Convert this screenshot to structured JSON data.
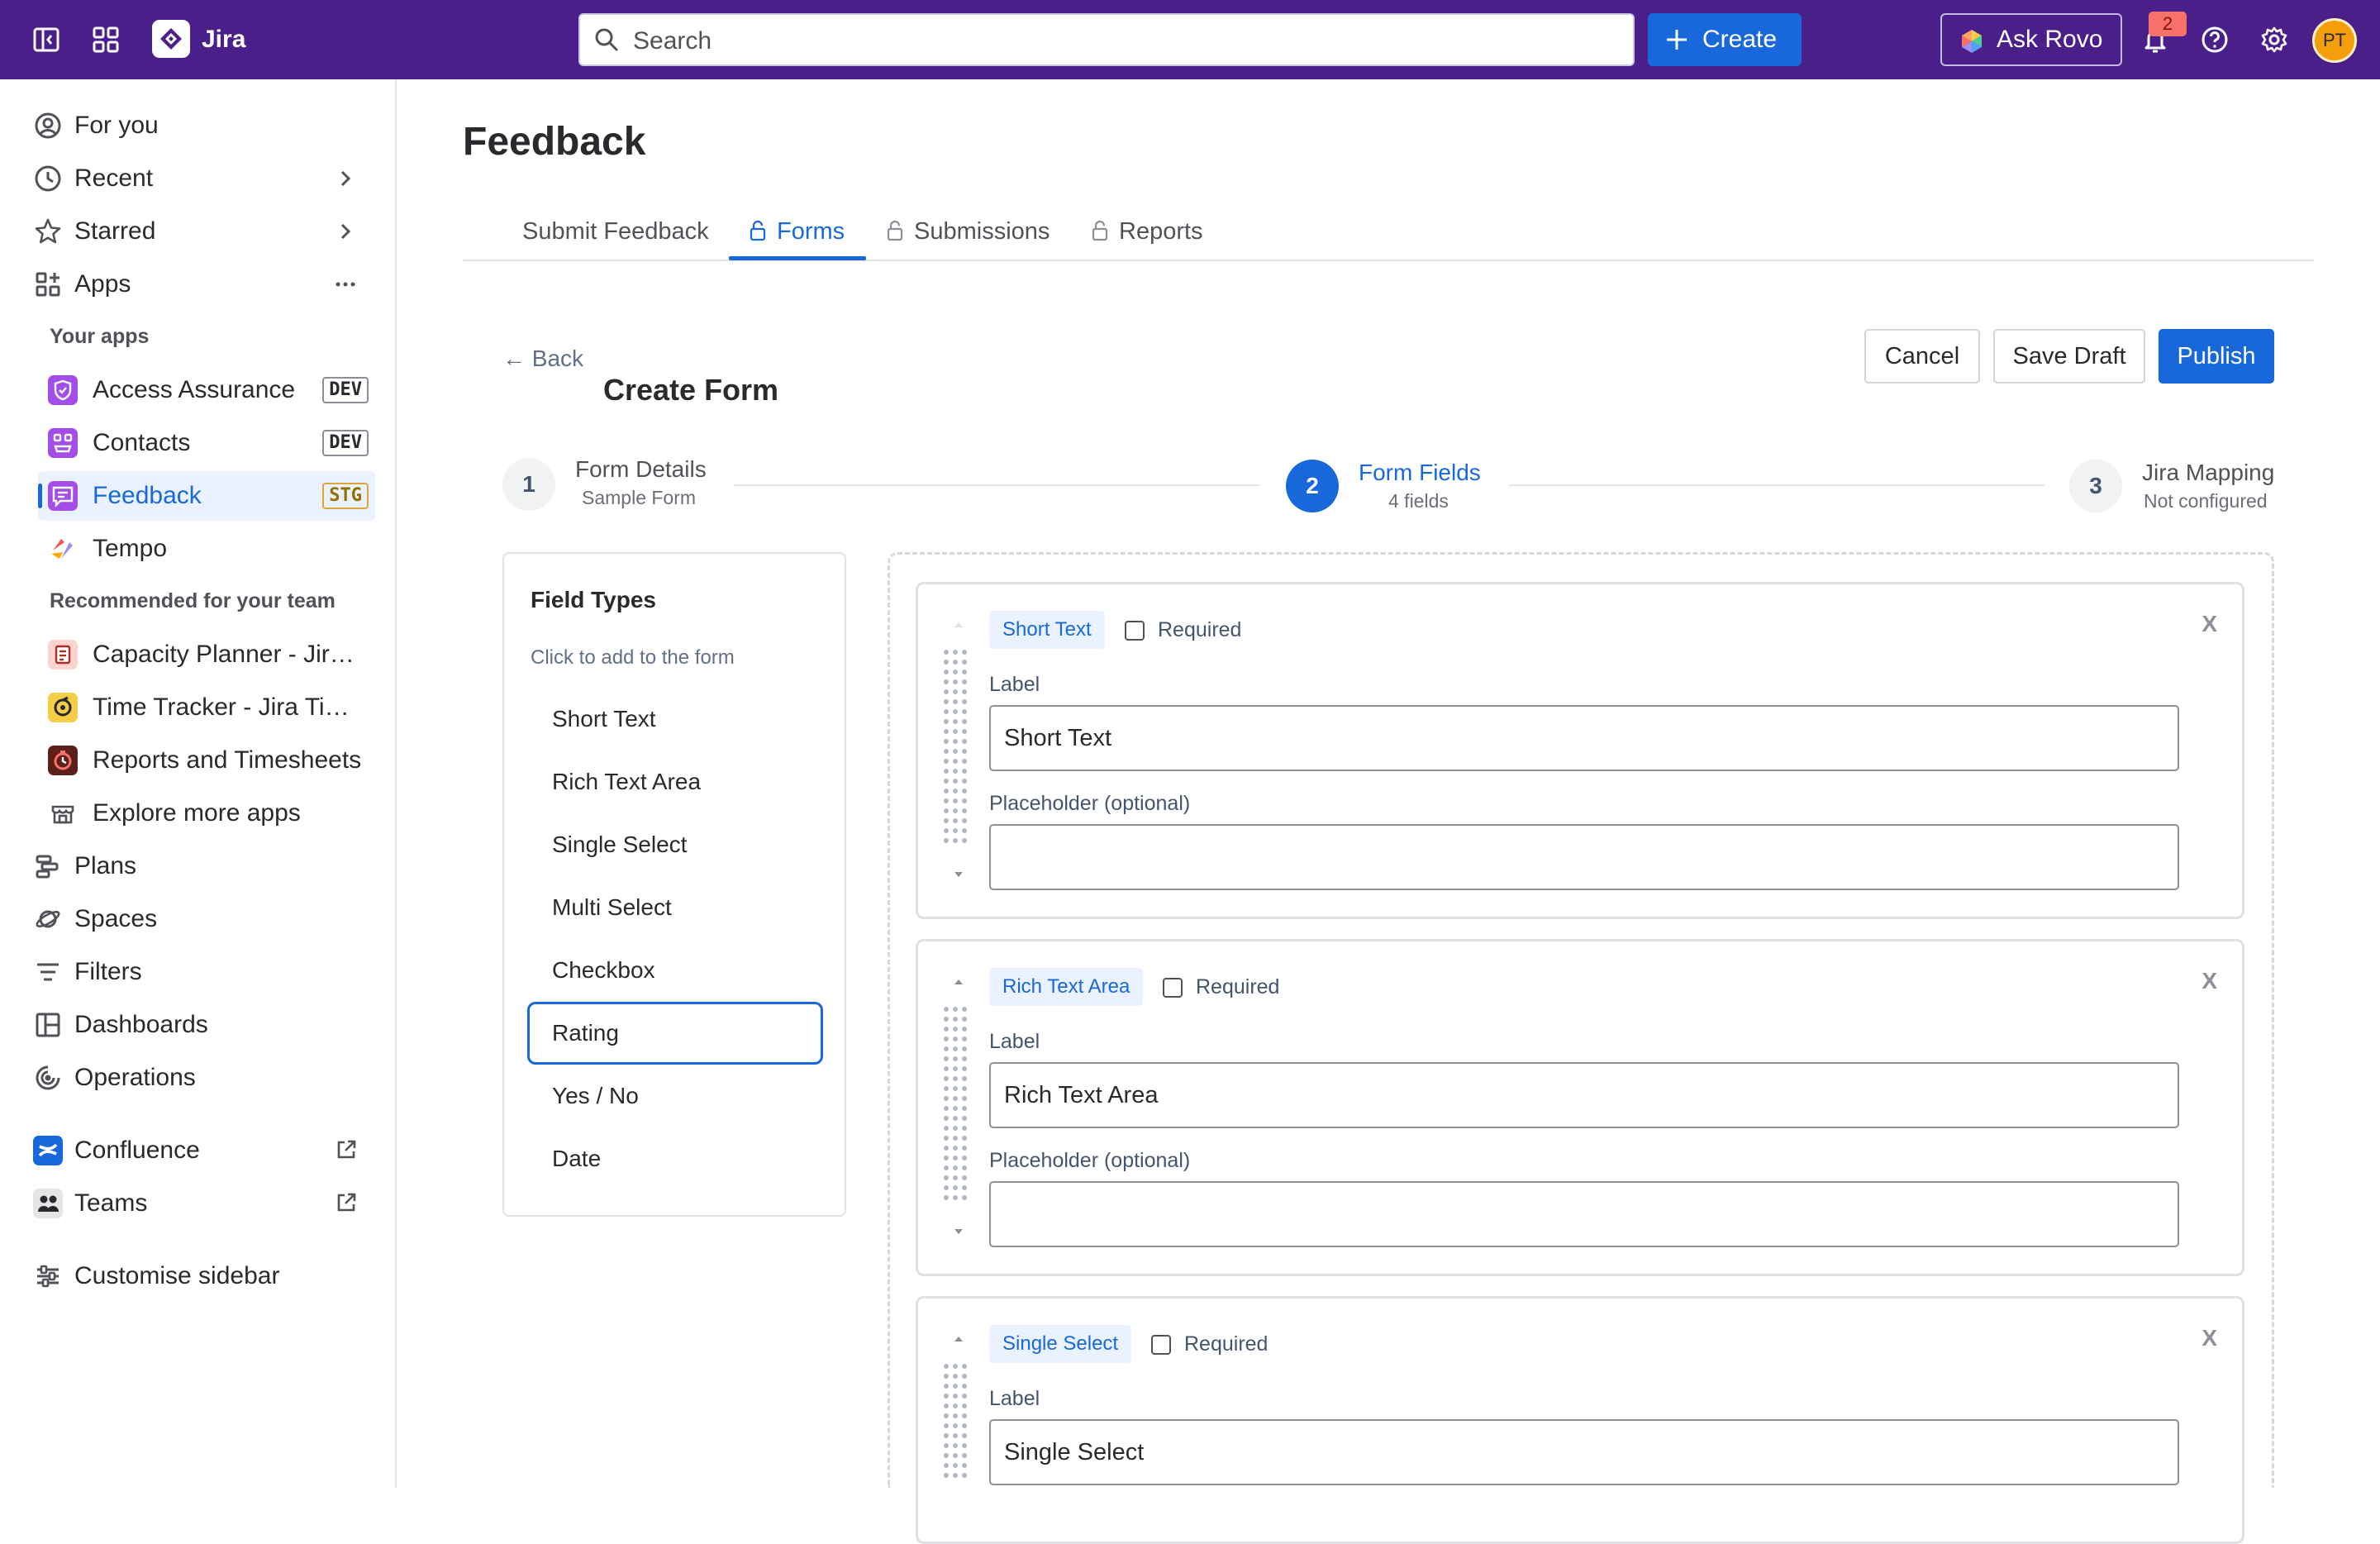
{
  "topbar": {
    "app_name": "Jira",
    "search_placeholder": "Search",
    "create_label": "Create",
    "rovo_label": "Ask Rovo",
    "notification_count": "2",
    "avatar_initials": "PT",
    "icons": [
      "sidebar-toggle-icon",
      "app-switcher-icon",
      "jira-logo-icon",
      "search-icon",
      "plus-icon",
      "rovo-icon",
      "bell-icon",
      "help-icon",
      "gear-icon"
    ],
    "colors": {
      "bar": "#4a1f8a",
      "primary": "#1868db",
      "badge": "#f87168",
      "avatar": "#f59e0b"
    }
  },
  "sidebar": {
    "for_you": "For you",
    "recent": "Recent",
    "starred": "Starred",
    "apps": "Apps",
    "your_apps_heading": "Your apps",
    "your_apps": [
      {
        "label": "Access Assurance",
        "tag": "DEV",
        "color": "#a54de8"
      },
      {
        "label": "Contacts",
        "tag": "DEV",
        "color": "#a54de8"
      },
      {
        "label": "Feedback",
        "tag": "STG",
        "color": "#a54de8"
      },
      {
        "label": "Tempo",
        "tag": "",
        "color": "#f15b50"
      }
    ],
    "recommended_heading": "Recommended for your team",
    "recommended": [
      {
        "label": "Capacity Planner - Jira Capacity Planning"
      },
      {
        "label": "Time Tracker - Jira Time Tracking"
      },
      {
        "label": "Reports and Timesheets"
      },
      {
        "label": "Explore more apps"
      }
    ],
    "plans": "Plans",
    "spaces": "Spaces",
    "filters": "Filters",
    "dashboards": "Dashboards",
    "operations": "Operations",
    "confluence": "Confluence",
    "teams": "Teams",
    "customise": "Customise sidebar"
  },
  "main": {
    "title": "Feedback",
    "tabs": [
      {
        "label": "Submit Feedback"
      },
      {
        "label": "Forms"
      },
      {
        "label": "Submissions"
      },
      {
        "label": "Reports"
      }
    ],
    "back_label": "← Back",
    "form_title": "Create Form",
    "buttons": {
      "cancel": "Cancel",
      "save_draft": "Save Draft",
      "publish": "Publish"
    },
    "steps": [
      {
        "num": "1",
        "title": "Form Details",
        "sub": "Sample Form"
      },
      {
        "num": "2",
        "title": "Form Fields",
        "sub": "4 fields"
      },
      {
        "num": "3",
        "title": "Jira Mapping",
        "sub": "Not configured"
      }
    ],
    "palette": {
      "title": "Field Types",
      "subtitle": "Click to add to the form",
      "items": [
        "Short Text",
        "Rich Text Area",
        "Single Select",
        "Multi Select",
        "Checkbox",
        "Rating",
        "Yes / No",
        "Date"
      ]
    },
    "fields": [
      {
        "type": "Short Text",
        "required_label": "Required",
        "label_caption": "Label",
        "label_value": "Short Text",
        "placeholder_caption": "Placeholder (optional)",
        "placeholder_value": "",
        "remove": "X"
      },
      {
        "type": "Rich Text Area",
        "required_label": "Required",
        "label_caption": "Label",
        "label_value": "Rich Text Area",
        "placeholder_caption": "Placeholder (optional)",
        "placeholder_value": "",
        "remove": "X"
      },
      {
        "type": "Single Select",
        "required_label": "Required",
        "label_caption": "Label",
        "label_value": "Single Select",
        "remove": "X"
      }
    ]
  }
}
